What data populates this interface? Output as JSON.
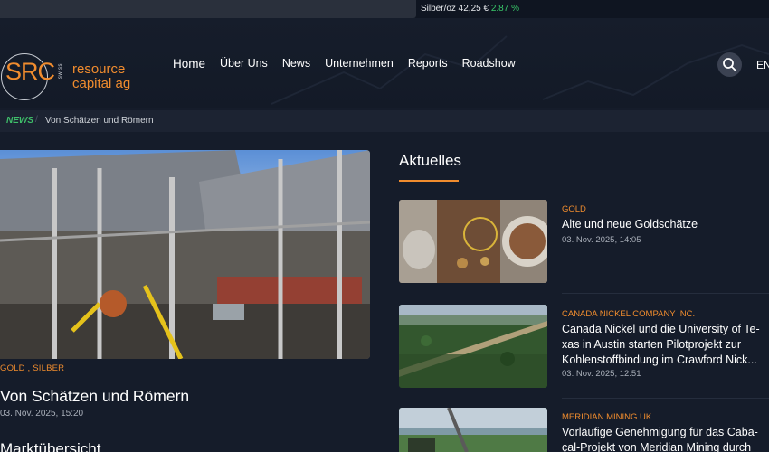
{
  "ticker": {
    "label": "Silber/oz 42,25 €",
    "change": "2.87 %"
  },
  "logo": {
    "main": "SRC",
    "swiss": "swiss",
    "line1": "resource",
    "line2": "capital ag"
  },
  "nav": {
    "items": [
      "Home",
      "Über Uns",
      "News",
      "Unternehmen",
      "Reports",
      "Roadshow"
    ],
    "lang": "EN"
  },
  "breadcrumb": {
    "section": "NEWS",
    "separator": "/",
    "title": "Von Schätzen und Römern"
  },
  "featured": {
    "category": "GOLD , SILBER",
    "title": "Von Schätzen und Römern",
    "date": "03. Nov. 2025, 15:20",
    "image": "mine-plant-photo"
  },
  "market": {
    "title": "Marktübersicht"
  },
  "sidebar": {
    "title": "Aktuelles",
    "items": [
      {
        "category": "GOLD",
        "title": "Alte und neue Goldschätze",
        "date": "03. Nov. 2025, 14:05",
        "image": "gold-nuggets-photo"
      },
      {
        "category": "CANADA NICKEL COMPANY INC.",
        "title": "Canada Nickel und die University of Te-xas in Austin starten Pilotprojekt zur Kohlenstoffbindung im Crawford Nick...",
        "date": "03. Nov. 2025, 12:51",
        "image": "forest-aerial-photo"
      },
      {
        "category": "MERIDIAN MINING UK",
        "title": "Vorläufige Genehmigung für das Caba-çal-Projekt von Meridian Mining durch",
        "image": "drill-rig-photo"
      }
    ]
  },
  "colors": {
    "accent": "#f08c2e",
    "positive": "#39c96a",
    "background": "#151c2a"
  }
}
